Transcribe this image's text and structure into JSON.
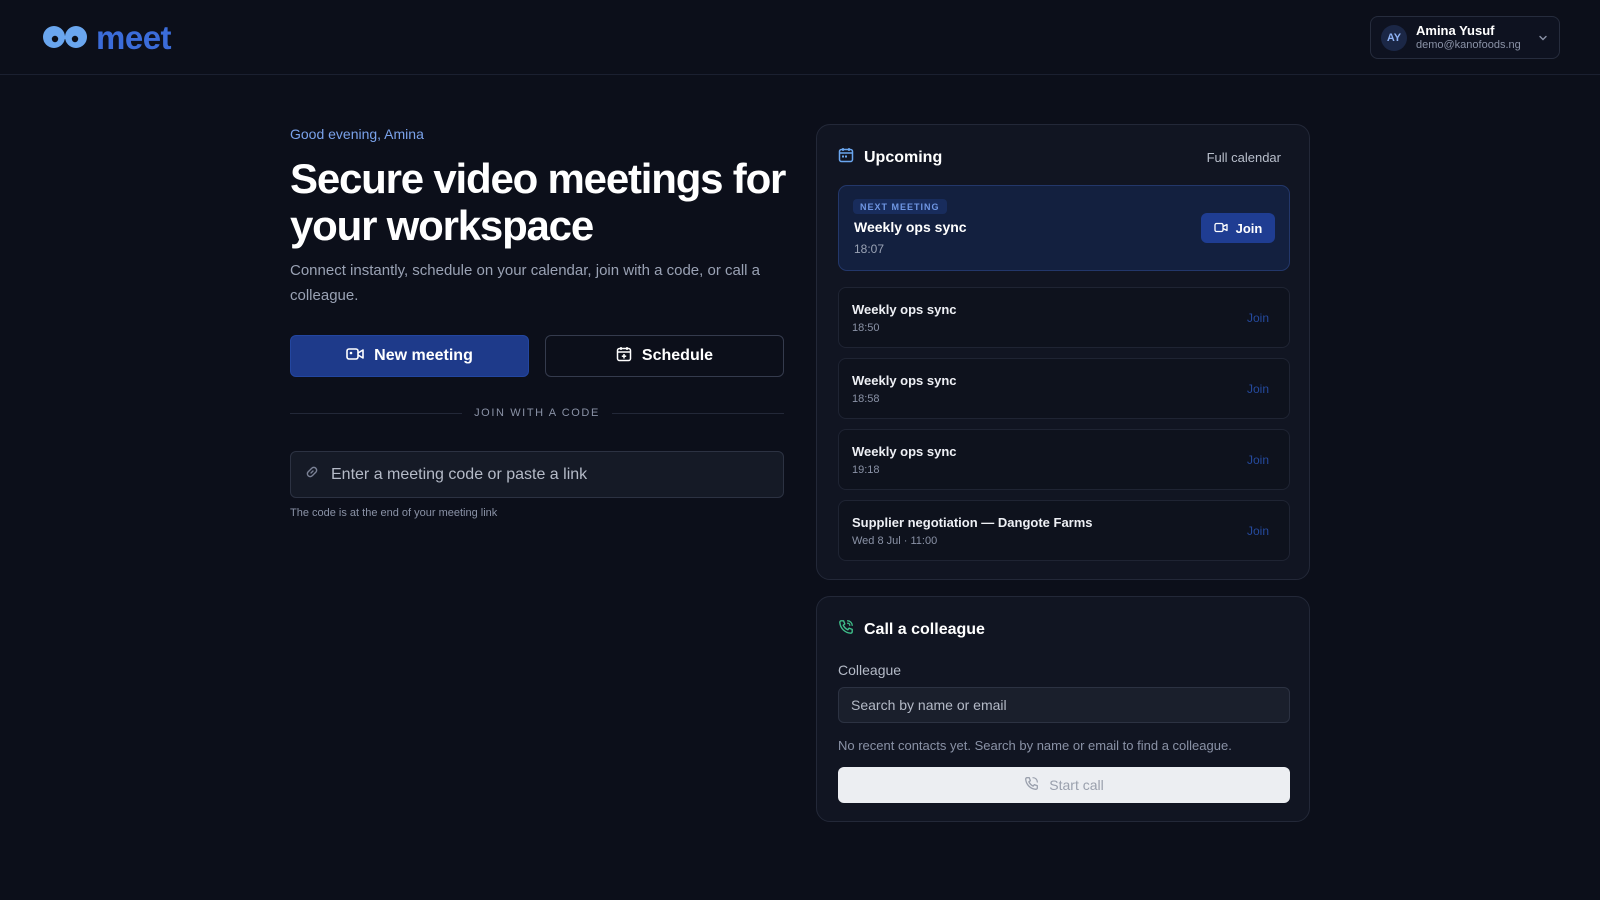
{
  "app": {
    "logo_text": "meet"
  },
  "account": {
    "initials": "AY",
    "name": "Amina Yusuf",
    "email": "demo@kanofoods.ng"
  },
  "hero": {
    "greeting": "Good evening, Amina",
    "title": "Secure video meetings for your workspace",
    "subtitle": "Connect instantly, schedule on your calendar, join with a code, or call a colleague.",
    "new_meeting_label": "New meeting",
    "schedule_label": "Schedule",
    "divider_label": "JOIN WITH A CODE",
    "code_placeholder": "Enter a meeting code or paste a link",
    "code_hint": "The code is at the end of your meeting link"
  },
  "upcoming": {
    "title": "Upcoming",
    "full_calendar_label": "Full calendar",
    "next": {
      "badge": "NEXT MEETING",
      "title": "Weekly ops sync",
      "time": "18:07",
      "join_label": "Join"
    },
    "meetings": [
      {
        "title": "Weekly ops sync",
        "time": "18:50",
        "join_label": "Join"
      },
      {
        "title": "Weekly ops sync",
        "time": "18:58",
        "join_label": "Join"
      },
      {
        "title": "Weekly ops sync",
        "time": "19:18",
        "join_label": "Join"
      },
      {
        "title": "Supplier negotiation — Dangote Farms",
        "time": "Wed 8 Jul · 11:00",
        "join_label": "Join"
      }
    ]
  },
  "call": {
    "title": "Call a colleague",
    "field_label": "Colleague",
    "search_placeholder": "Search by name or email",
    "empty_text": "No recent contacts yet. Search by name or email to find a colleague.",
    "start_call_label": "Start call"
  },
  "icons": {
    "logo": "logo-mark-icon",
    "chevron": "chevron-down-icon",
    "video": "video-camera-icon",
    "calendar": "calendar-icon",
    "calendar_add": "calendar-plus-icon",
    "link": "link-icon",
    "phone": "phone-icon"
  },
  "colors": {
    "background": "#0c0f1a",
    "accent": "#1e3a8a",
    "accent_text": "#7aa2ea",
    "call_green": "#3fbf8a"
  }
}
